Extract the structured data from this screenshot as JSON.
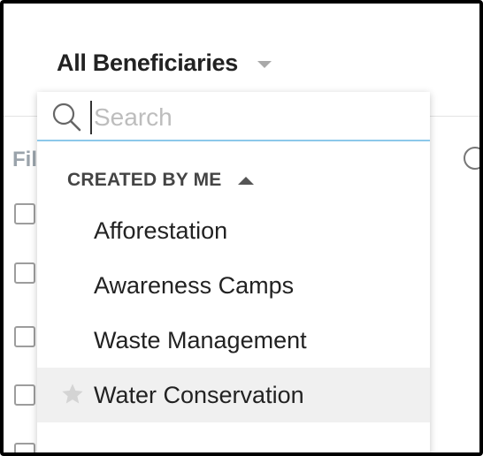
{
  "header": {
    "view_title": "All Beneficiaries"
  },
  "background": {
    "filter_label": "Fil"
  },
  "dropdown": {
    "search": {
      "placeholder": "Search",
      "value": ""
    },
    "group": {
      "title": "CREATED BY ME",
      "expanded": true
    },
    "items": [
      {
        "label": "Afforestation",
        "highlighted": false,
        "starred": false
      },
      {
        "label": "Awareness Camps",
        "highlighted": false,
        "starred": false
      },
      {
        "label": "Waste Management",
        "highlighted": false,
        "starred": false
      },
      {
        "label": "Water Conservation",
        "highlighted": true,
        "starred": false
      }
    ]
  },
  "colors": {
    "search_underline": "#8cc8ea",
    "highlight_bg": "#f0f0f0",
    "star": "#d4d4d4"
  }
}
